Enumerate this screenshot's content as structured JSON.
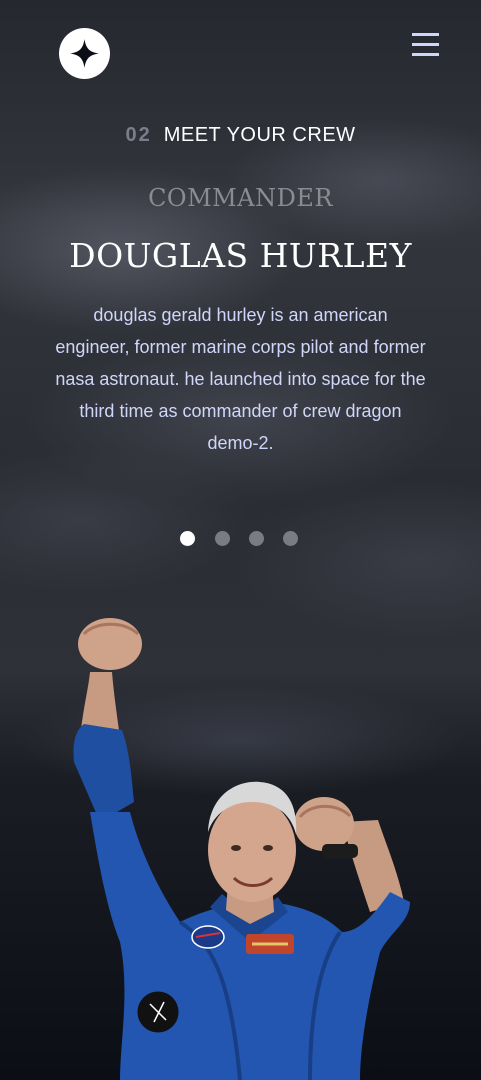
{
  "header": {
    "logo_icon": "star-logo-icon",
    "menu_icon": "hamburger-menu-icon"
  },
  "section": {
    "number": "02",
    "title": "MEET YOUR CREW"
  },
  "crew": {
    "role": "COMMANDER",
    "name": "DOUGLAS HURLEY",
    "bio": "douglas gerald hurley is an american engineer, former marine corps pilot and former nasa astronaut. he launched into space for the third time as commander of crew dragon demo-2.",
    "photo_alt": "Douglas Hurley"
  },
  "pagination": {
    "count": 4,
    "active_index": 0
  },
  "colors": {
    "background": "#0b0d17",
    "accent": "#d0d6f9",
    "muted": "#7b7e88"
  }
}
